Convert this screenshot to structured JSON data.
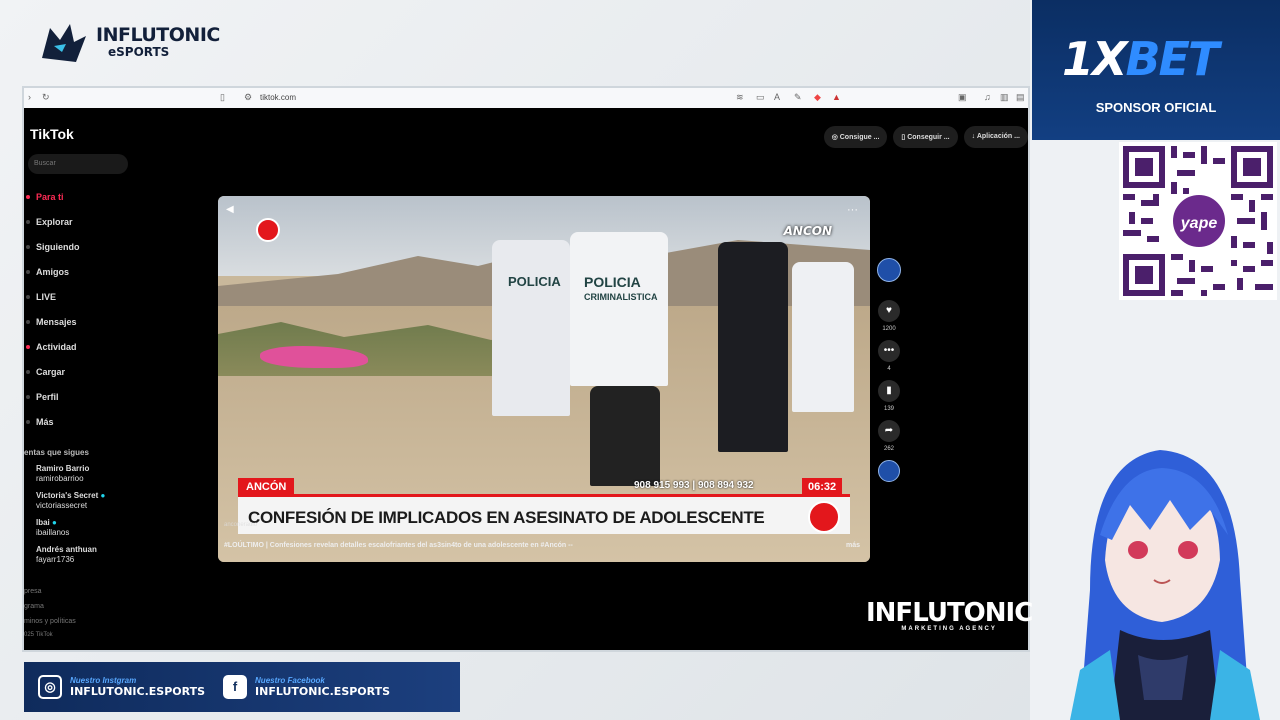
{
  "brand": {
    "logo_line1": "INFLUTONIC",
    "logo_line2": "eSPORTS"
  },
  "browser": {
    "url": "tiktok.com"
  },
  "tiktok": {
    "logo": "TikTok",
    "search_placeholder": "Buscar",
    "nav": [
      "Para ti",
      "Explorar",
      "Siguiendo",
      "Amigos",
      "LIVE",
      "Mensajes",
      "Actividad",
      "Cargar",
      "Perfil",
      "Más"
    ],
    "following_header": "entas que sigues",
    "accounts": [
      {
        "name": "Ramiro Barrio",
        "handle": "ramirobarrioo"
      },
      {
        "name": "Victoria's Secret",
        "handle": "victoriassecret"
      },
      {
        "name": "Ibai",
        "handle": "ibaillanos"
      },
      {
        "name": "Andrés anthuan",
        "handle": "fayarr1736"
      }
    ],
    "footer": [
      "presa",
      "grama",
      "minos y políticas",
      "025 TikTok"
    ],
    "top_actions": [
      "Consigue ...",
      "Conseguir ...",
      "Aplicación ..."
    ]
  },
  "video": {
    "location": "ANCÓN",
    "phones": "908 915 993  |  908 894 932",
    "time": "06:32",
    "headline": "CONFESIÓN DE IMPLICADOS EN ASESINATO DE ADOLESCENTE",
    "watermark": "anconeradio",
    "caption": "#LOÚLTIMO | Confesiones revelan detalles escalofriantes del as3sin4to de una adolescente en #Ancón --",
    "more": "más",
    "channel_badge": "ANCON",
    "vest_text_1": "POLICIA",
    "vest_text_2": "CRIMINALISTICA"
  },
  "rail": {
    "likes": "1200",
    "comments": "4",
    "saves": "139",
    "shares": "262"
  },
  "agency": {
    "name": "INFLUTONIC",
    "tag": "MARKETING AGENCY"
  },
  "sponsor": {
    "brand_1x": "1X",
    "brand_bet": "BET",
    "label": "SPONSOR OFICIAL"
  },
  "qr": {
    "label": "yape"
  },
  "social": {
    "instagram_label": "Nuestro Instgram",
    "instagram_handle": "INFLUTONIC.ESPORTS",
    "facebook_label": "Nuestro Facebook",
    "facebook_handle": "INFLUTONIC.ESPORTS"
  },
  "colors": {
    "tiktok_red": "#fe2c55",
    "news_red": "#e3171c",
    "sponsor_blue": "#0b2e63"
  }
}
